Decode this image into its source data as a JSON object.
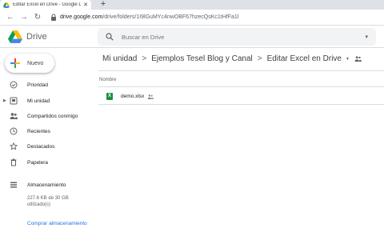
{
  "browser": {
    "tab_title": "Editar Excel en Drive - Google D",
    "tab_close": "✕",
    "new_tab": "+",
    "url_host": "drive.google.com",
    "url_path": "/drive/folders/1I9lGuMYc4nwOBF67hzecQsKc1tHfFa1l"
  },
  "header": {
    "app_name": "Drive",
    "search_placeholder": "Buscar en Drive"
  },
  "sidebar": {
    "new_label": "Nuevo",
    "items": [
      {
        "label": "Prioridad",
        "icon": "check-circle-icon"
      },
      {
        "label": "Mi unidad",
        "icon": "my-drive-icon"
      },
      {
        "label": "Compartidos conmigo",
        "icon": "shared-people-icon"
      },
      {
        "label": "Recientes",
        "icon": "clock-icon"
      },
      {
        "label": "Destacados",
        "icon": "star-icon"
      },
      {
        "label": "Papelera",
        "icon": "trash-icon"
      },
      {
        "label": "Almacenamiento",
        "icon": "storage-icon"
      }
    ],
    "storage_text": "227.6 KB de 30 GB utilizado(s)",
    "storage_link": "Comprar almacenamiento"
  },
  "breadcrumb": [
    "Mi unidad",
    "Ejemplos Tesel Blog y Canal",
    "Editar Excel en Drive"
  ],
  "breadcrumb_sep": ">",
  "list": {
    "column_name": "Nombre",
    "files": [
      {
        "name": "demo.xlsx",
        "icon": "excel-icon",
        "shared": true
      }
    ]
  },
  "colors": {
    "accent": "#1a73e8",
    "excel_green": "#1e8e3e"
  }
}
